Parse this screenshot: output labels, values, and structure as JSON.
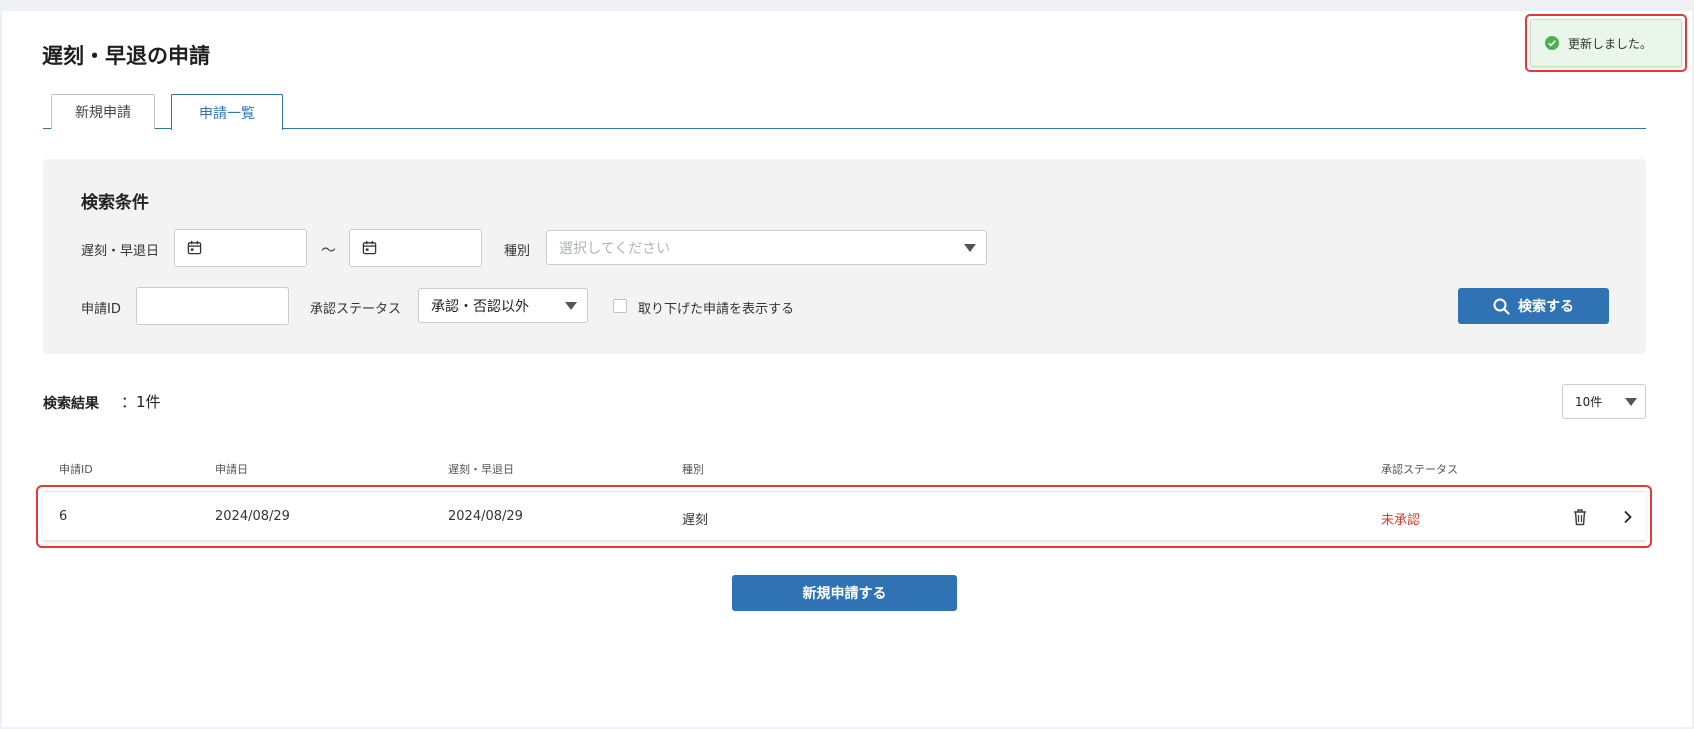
{
  "page": {
    "title": "遅刻・早退の申請"
  },
  "tabs": [
    {
      "label": "新規申請",
      "active": false
    },
    {
      "label": "申請一覧",
      "active": true
    }
  ],
  "search": {
    "title": "検索条件",
    "date_label": "遅刻・早退日",
    "date_from_value": "",
    "date_to_value": "",
    "range_separator": "～",
    "type_label": "種別",
    "type_placeholder": "選択してください",
    "id_label": "申請ID",
    "id_value": "",
    "status_label": "承認ステータス",
    "status_selected": "承認・否認以外",
    "withdrawn_checkbox_label": "取り下げた申請を表示する",
    "withdrawn_checked": false,
    "search_button": "検索する"
  },
  "results": {
    "label": "検索結果",
    "count_text": "：1件",
    "page_size": "10件",
    "columns": [
      "申請ID",
      "申請日",
      "遅刻・早退日",
      "種別",
      "承認ステータス"
    ],
    "rows": [
      {
        "id": "6",
        "applied_date": "2024/08/29",
        "target_date": "2024/08/29",
        "type": "遅刻",
        "status": "未承認"
      }
    ]
  },
  "actions": {
    "new_request_button": "新規申請する"
  },
  "toast": {
    "message": "更新しました。"
  },
  "colors": {
    "primary": "#2f73b5",
    "status_pending": "#e53935",
    "toast_bg": "#eaf6ea",
    "toast_icon": "#4caf50"
  }
}
